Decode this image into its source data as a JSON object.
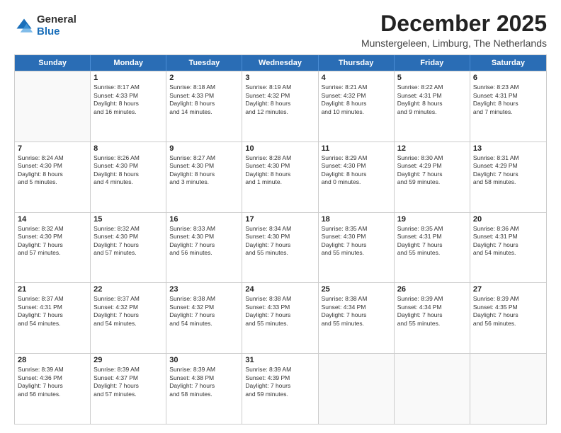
{
  "logo": {
    "general": "General",
    "blue": "Blue"
  },
  "header": {
    "month": "December 2025",
    "location": "Munstergeleen, Limburg, The Netherlands"
  },
  "weekdays": [
    "Sunday",
    "Monday",
    "Tuesday",
    "Wednesday",
    "Thursday",
    "Friday",
    "Saturday"
  ],
  "rows": [
    [
      {
        "day": "",
        "info": ""
      },
      {
        "day": "1",
        "info": "Sunrise: 8:17 AM\nSunset: 4:33 PM\nDaylight: 8 hours\nand 16 minutes."
      },
      {
        "day": "2",
        "info": "Sunrise: 8:18 AM\nSunset: 4:33 PM\nDaylight: 8 hours\nand 14 minutes."
      },
      {
        "day": "3",
        "info": "Sunrise: 8:19 AM\nSunset: 4:32 PM\nDaylight: 8 hours\nand 12 minutes."
      },
      {
        "day": "4",
        "info": "Sunrise: 8:21 AM\nSunset: 4:32 PM\nDaylight: 8 hours\nand 10 minutes."
      },
      {
        "day": "5",
        "info": "Sunrise: 8:22 AM\nSunset: 4:31 PM\nDaylight: 8 hours\nand 9 minutes."
      },
      {
        "day": "6",
        "info": "Sunrise: 8:23 AM\nSunset: 4:31 PM\nDaylight: 8 hours\nand 7 minutes."
      }
    ],
    [
      {
        "day": "7",
        "info": "Sunrise: 8:24 AM\nSunset: 4:30 PM\nDaylight: 8 hours\nand 5 minutes."
      },
      {
        "day": "8",
        "info": "Sunrise: 8:26 AM\nSunset: 4:30 PM\nDaylight: 8 hours\nand 4 minutes."
      },
      {
        "day": "9",
        "info": "Sunrise: 8:27 AM\nSunset: 4:30 PM\nDaylight: 8 hours\nand 3 minutes."
      },
      {
        "day": "10",
        "info": "Sunrise: 8:28 AM\nSunset: 4:30 PM\nDaylight: 8 hours\nand 1 minute."
      },
      {
        "day": "11",
        "info": "Sunrise: 8:29 AM\nSunset: 4:30 PM\nDaylight: 8 hours\nand 0 minutes."
      },
      {
        "day": "12",
        "info": "Sunrise: 8:30 AM\nSunset: 4:29 PM\nDaylight: 7 hours\nand 59 minutes."
      },
      {
        "day": "13",
        "info": "Sunrise: 8:31 AM\nSunset: 4:29 PM\nDaylight: 7 hours\nand 58 minutes."
      }
    ],
    [
      {
        "day": "14",
        "info": "Sunrise: 8:32 AM\nSunset: 4:30 PM\nDaylight: 7 hours\nand 57 minutes."
      },
      {
        "day": "15",
        "info": "Sunrise: 8:32 AM\nSunset: 4:30 PM\nDaylight: 7 hours\nand 57 minutes."
      },
      {
        "day": "16",
        "info": "Sunrise: 8:33 AM\nSunset: 4:30 PM\nDaylight: 7 hours\nand 56 minutes."
      },
      {
        "day": "17",
        "info": "Sunrise: 8:34 AM\nSunset: 4:30 PM\nDaylight: 7 hours\nand 55 minutes."
      },
      {
        "day": "18",
        "info": "Sunrise: 8:35 AM\nSunset: 4:30 PM\nDaylight: 7 hours\nand 55 minutes."
      },
      {
        "day": "19",
        "info": "Sunrise: 8:35 AM\nSunset: 4:31 PM\nDaylight: 7 hours\nand 55 minutes."
      },
      {
        "day": "20",
        "info": "Sunrise: 8:36 AM\nSunset: 4:31 PM\nDaylight: 7 hours\nand 54 minutes."
      }
    ],
    [
      {
        "day": "21",
        "info": "Sunrise: 8:37 AM\nSunset: 4:31 PM\nDaylight: 7 hours\nand 54 minutes."
      },
      {
        "day": "22",
        "info": "Sunrise: 8:37 AM\nSunset: 4:32 PM\nDaylight: 7 hours\nand 54 minutes."
      },
      {
        "day": "23",
        "info": "Sunrise: 8:38 AM\nSunset: 4:32 PM\nDaylight: 7 hours\nand 54 minutes."
      },
      {
        "day": "24",
        "info": "Sunrise: 8:38 AM\nSunset: 4:33 PM\nDaylight: 7 hours\nand 55 minutes."
      },
      {
        "day": "25",
        "info": "Sunrise: 8:38 AM\nSunset: 4:34 PM\nDaylight: 7 hours\nand 55 minutes."
      },
      {
        "day": "26",
        "info": "Sunrise: 8:39 AM\nSunset: 4:34 PM\nDaylight: 7 hours\nand 55 minutes."
      },
      {
        "day": "27",
        "info": "Sunrise: 8:39 AM\nSunset: 4:35 PM\nDaylight: 7 hours\nand 56 minutes."
      }
    ],
    [
      {
        "day": "28",
        "info": "Sunrise: 8:39 AM\nSunset: 4:36 PM\nDaylight: 7 hours\nand 56 minutes."
      },
      {
        "day": "29",
        "info": "Sunrise: 8:39 AM\nSunset: 4:37 PM\nDaylight: 7 hours\nand 57 minutes."
      },
      {
        "day": "30",
        "info": "Sunrise: 8:39 AM\nSunset: 4:38 PM\nDaylight: 7 hours\nand 58 minutes."
      },
      {
        "day": "31",
        "info": "Sunrise: 8:39 AM\nSunset: 4:39 PM\nDaylight: 7 hours\nand 59 minutes."
      },
      {
        "day": "",
        "info": ""
      },
      {
        "day": "",
        "info": ""
      },
      {
        "day": "",
        "info": ""
      }
    ]
  ]
}
